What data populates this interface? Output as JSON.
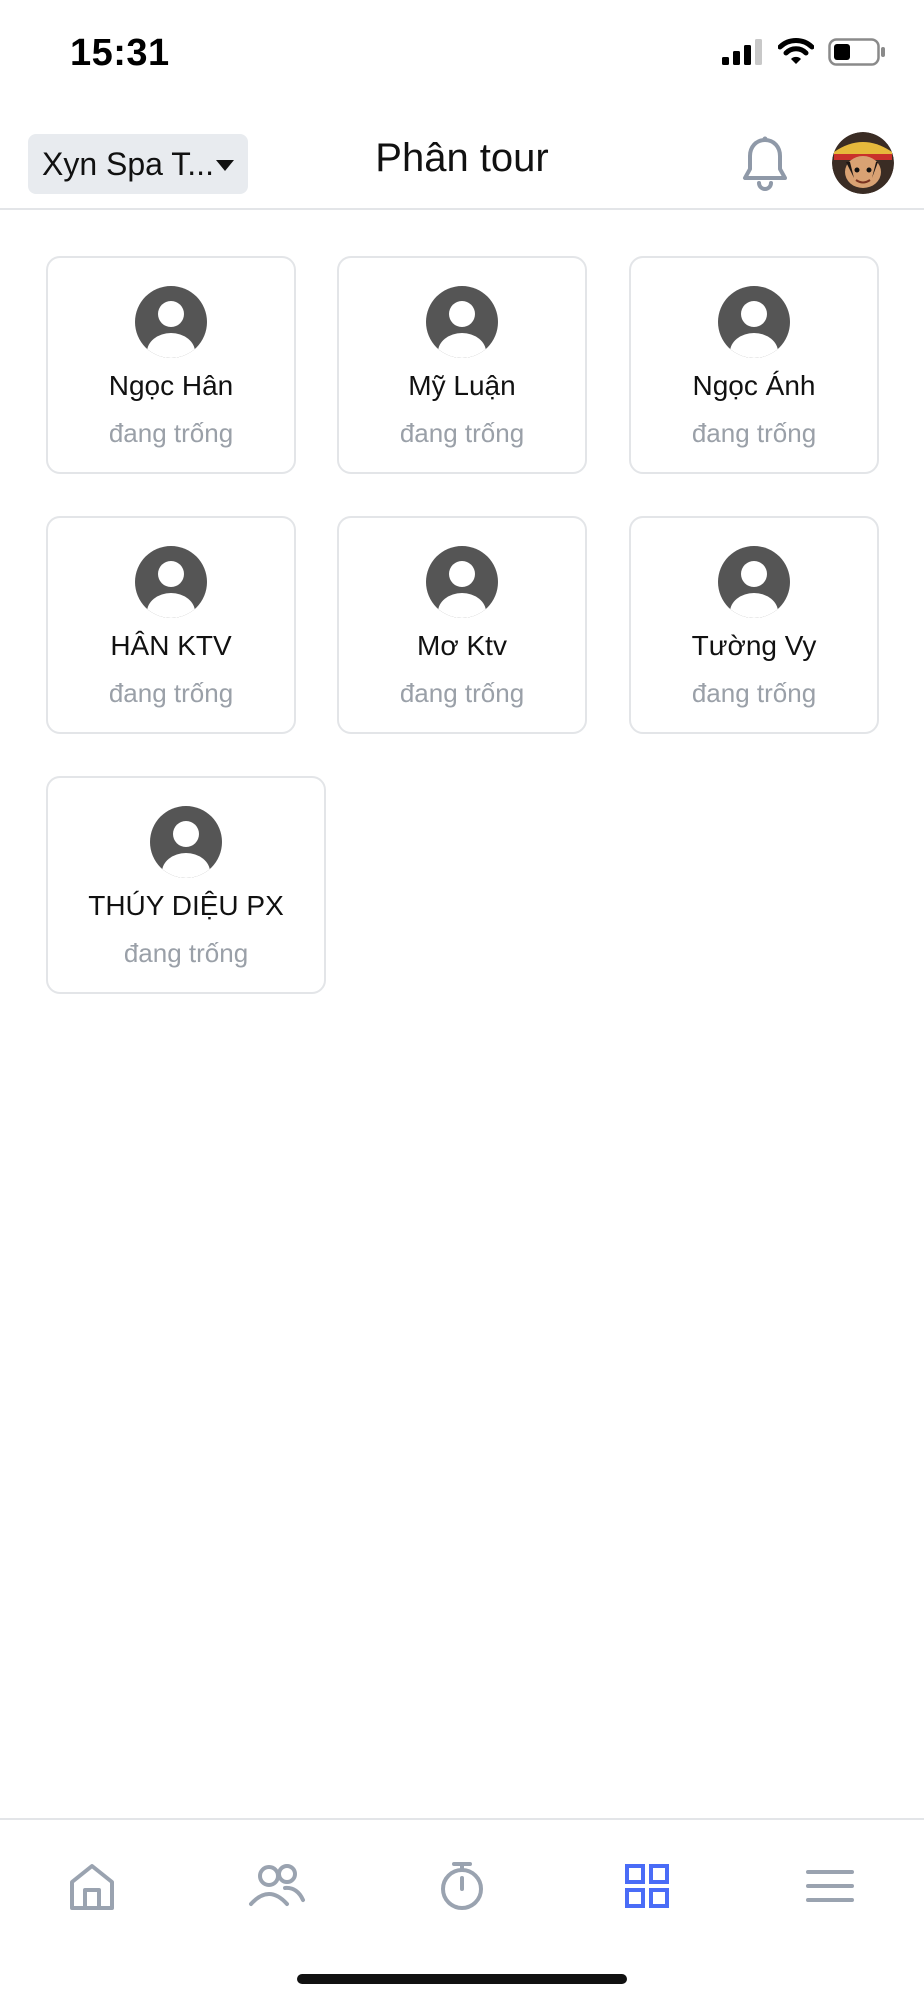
{
  "status_bar": {
    "time": "15:31"
  },
  "header": {
    "store_selector": "Xyn Spa T...",
    "title": "Phân tour"
  },
  "staff": [
    {
      "name": "Ngọc Hân",
      "status": "đang trống"
    },
    {
      "name": "Mỹ Luận",
      "status": "đang trống"
    },
    {
      "name": "Ngọc Ánh",
      "status": "đang trống"
    },
    {
      "name": "HÂN KTV",
      "status": "đang trống"
    },
    {
      "name": "Mơ Ktv",
      "status": "đang trống"
    },
    {
      "name": "Tường Vy",
      "status": "đang trống"
    },
    {
      "name": "THÚY DIỆU PX",
      "status": "đang trống"
    }
  ],
  "tab_bar": {
    "tabs": [
      {
        "icon": "home-icon",
        "active": false
      },
      {
        "icon": "users-icon",
        "active": false
      },
      {
        "icon": "timer-icon",
        "active": false
      },
      {
        "icon": "grid-icon",
        "active": true
      },
      {
        "icon": "menu-icon",
        "active": false
      }
    ]
  },
  "colors": {
    "active_tab": "#4a6cf7",
    "inactive_tab": "#9aa3b0",
    "avatar_placeholder": "#555555",
    "muted_text": "#9aa0a8"
  }
}
